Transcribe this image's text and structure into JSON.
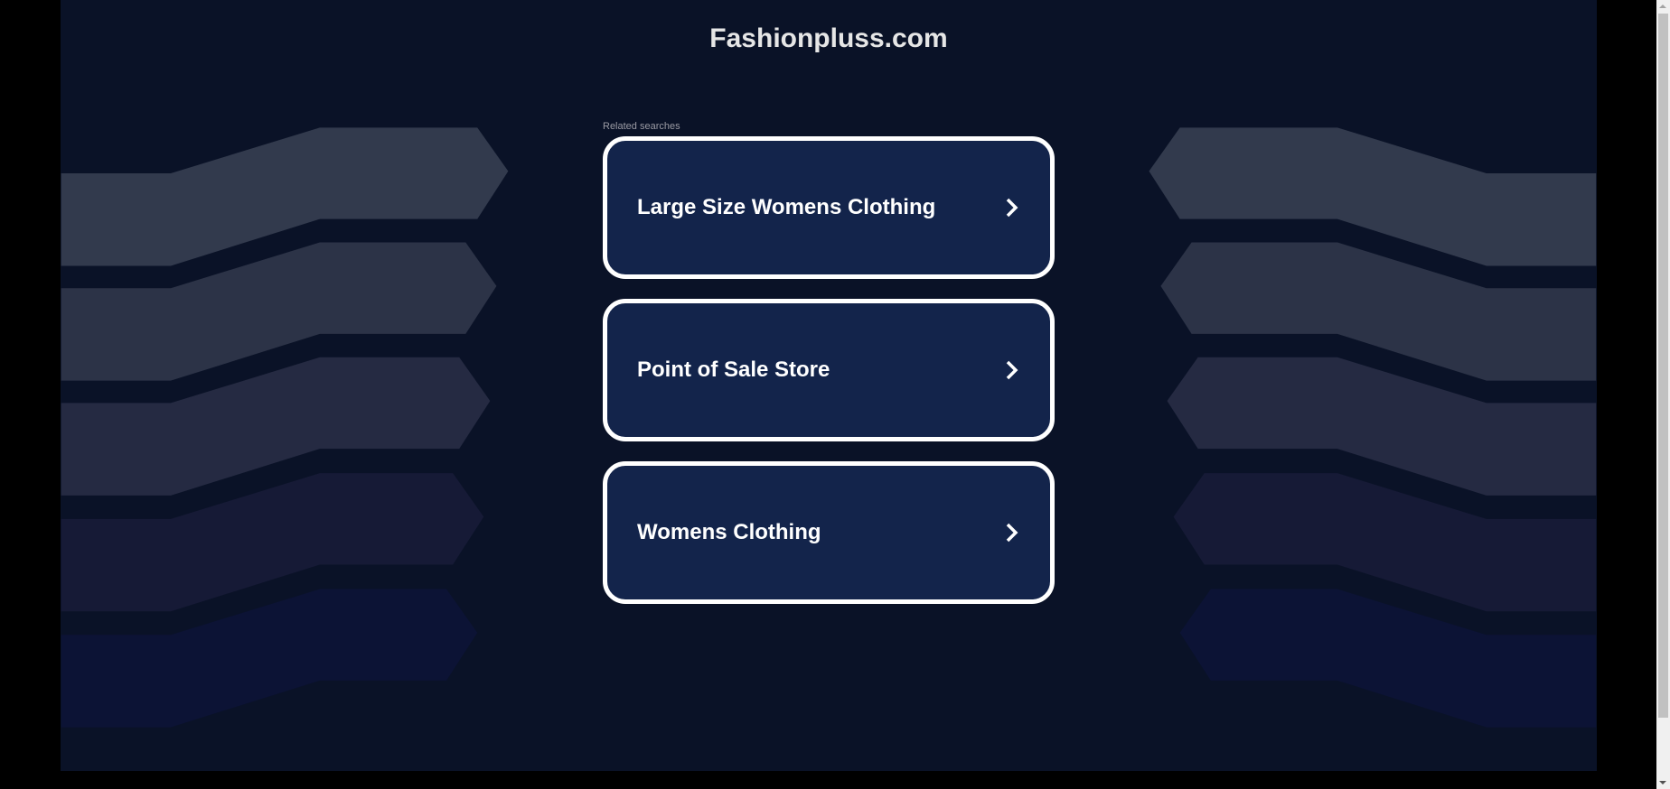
{
  "header": {
    "title": "Fashionpluss.com"
  },
  "related": {
    "label": "Related searches",
    "items": [
      {
        "label": "Large Size Womens Clothing"
      },
      {
        "label": "Point of Sale Store"
      },
      {
        "label": "Womens Clothing"
      }
    ]
  },
  "colors": {
    "background": "#0a1227",
    "card": "#13244b",
    "bands": [
      "#323a4d",
      "#2c3347",
      "#252a42",
      "#161a36",
      "#0c1335"
    ]
  }
}
